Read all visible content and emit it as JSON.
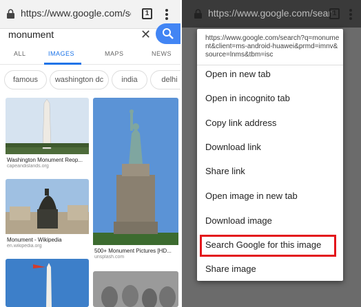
{
  "left": {
    "url": "https://www.google.com/sear",
    "tab_count": "1",
    "query": "monument",
    "clear_glyph": "✕",
    "nav_tabs": [
      "ALL",
      "IMAGES",
      "MAPS",
      "NEWS"
    ],
    "chips": [
      "famous",
      "washington dc",
      "india",
      "delhi"
    ],
    "results": [
      {
        "title": "Washington Monument Reop...",
        "source": "capeandislands.org"
      },
      {
        "title": "Monument - Wikipedia",
        "source": "en.wikipedia.org"
      },
      {
        "title": "500+ Monument Pictures [HD...",
        "source": "unsplash.com"
      }
    ]
  },
  "right": {
    "url": "https://www.google.com/sear",
    "tab_count": "1",
    "menu_url": "https://www.google.com/search?q=monument&client=ms-android-huawei&prmd=imnv&source=lnms&tbm=isc",
    "menu_items": [
      "Open in new tab",
      "Open in incognito tab",
      "Copy link address",
      "Download link",
      "Share link",
      "Open image in new tab",
      "Download image",
      "Search Google for this image",
      "Share image"
    ],
    "highlight_color": "#e3141a"
  }
}
